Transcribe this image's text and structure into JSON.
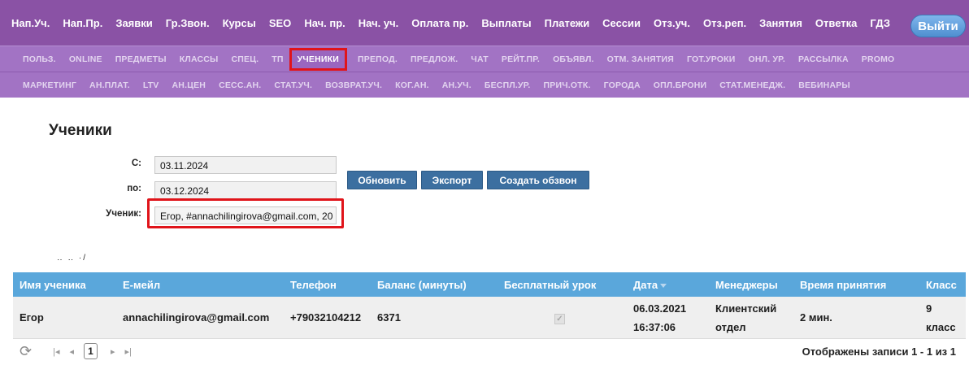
{
  "topnav": {
    "items": [
      "Нап.Уч.",
      "Нап.Пр.",
      "Заявки",
      "Гр.Звон.",
      "Курсы",
      "SEO",
      "Нач. пр.",
      "Нач. уч.",
      "Оплата пр.",
      "Выплаты",
      "Платежи",
      "Сессии",
      "Отз.уч.",
      "Отз.реп.",
      "Занятия",
      "Ответка",
      "ГДЗ"
    ],
    "logout_label": "Выйти"
  },
  "subnav_row1": [
    "ПОЛЬЗ.",
    "ONLINE",
    "ПРЕДМЕТЫ",
    "КЛАССЫ",
    "СПЕЦ.",
    "ТП",
    "УЧЕНИКИ",
    "ПРЕПОД.",
    "ПРЕДЛОЖ.",
    "ЧАТ",
    "РЕЙТ.ПР.",
    "ОБЪЯВЛ.",
    "ОТМ. ЗАНЯТИЯ",
    "ГОТ.УРОКИ",
    "ОНЛ. УР.",
    "РАССЫЛКА",
    "PROMO"
  ],
  "subnav_row2": [
    "МАРКЕТИНГ",
    "АН.ПЛАТ.",
    "LTV",
    "АН.ЦЕН",
    "СЕСС.АН.",
    "СТАТ.УЧ.",
    "ВОЗВРАТ.УЧ.",
    "КОГ.АН.",
    "АН.УЧ.",
    "БЕСПЛ.УР.",
    "ПРИЧ.ОТК.",
    "ГОРОДА",
    "ОПЛ.БРОНИ",
    "СТАТ.МЕНЕДЖ.",
    "ВЕБИНАРЫ"
  ],
  "active_subnav": "УЧЕНИКИ",
  "page": {
    "title": "Ученики"
  },
  "filter": {
    "from_label": "С:",
    "from_value": "03.11.2024",
    "to_label": "по:",
    "to_value": "03.12.2024",
    "student_label": "Ученик:",
    "student_value": "Егор, #annachilingirova@gmail.com, 20"
  },
  "buttons": {
    "refresh": "Обновить",
    "export": "Экспорт",
    "create_call": "Создать обзвон"
  },
  "table": {
    "columns": [
      "Имя ученика",
      "Е-мейл",
      "Телефон",
      "Баланс (минуты)",
      "Бесплатный урок",
      "Дата",
      "Менеджеры",
      "Время принятия",
      "Класс"
    ],
    "rows": [
      {
        "name": "Егор",
        "email": "annachilingirova@gmail.com",
        "phone": "+79032104212",
        "balance": "6371",
        "free_lesson_checked": true,
        "date_line1": "06.03.2021",
        "date_line2": "16:37:06",
        "manager_line1": "Клиентский",
        "manager_line2": "отдел",
        "accept_time": "2 мин.",
        "class_line1": "9",
        "class_line2": "класс"
      }
    ]
  },
  "pager": {
    "current_page": "1",
    "status": "Отображены записи 1 - 1 из 1"
  },
  "colors": {
    "topnav_bg": "#8a52a5",
    "subnav_bg": "#a273c4",
    "table_header_bg": "#5aa7db",
    "button_bg": "#3c6fa0",
    "highlight_outline": "#e0141a"
  }
}
